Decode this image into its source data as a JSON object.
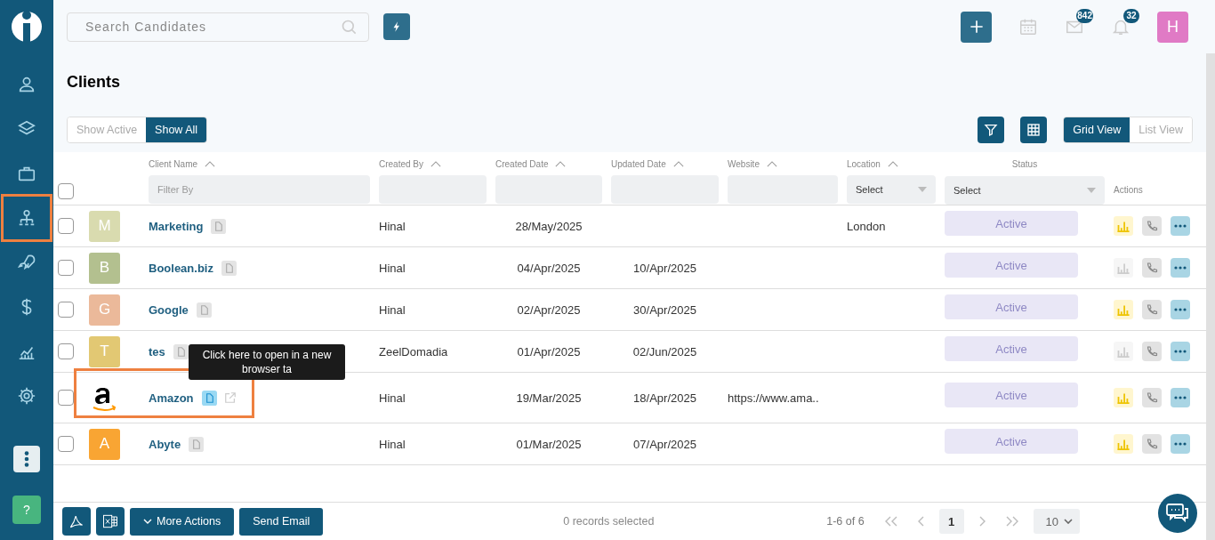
{
  "sidebar": {
    "items": [
      {
        "selected": false
      },
      {
        "selected": false
      },
      {
        "selected": false
      },
      {
        "selected": true
      },
      {
        "selected": false
      },
      {
        "selected": false
      },
      {
        "selected": false
      },
      {
        "selected": false
      }
    ],
    "help_label": "?"
  },
  "topbar": {
    "search": {
      "placeholder": "Search Candidates"
    },
    "mail_badge": "842",
    "bell_badge": "32",
    "avatar_letter": "H"
  },
  "page": {
    "title": "Clients",
    "filter_toggle": [
      {
        "label": "Show Active",
        "selected": false
      },
      {
        "label": "Show All",
        "selected": true
      }
    ],
    "view_toggle": [
      {
        "label": "Grid View",
        "selected": true
      },
      {
        "label": "List View",
        "selected": false
      }
    ]
  },
  "table": {
    "columns": [
      {
        "label": "Client Name",
        "sortable": true,
        "kind": "text",
        "placeholder": "Filter By"
      },
      {
        "label": "Created By",
        "sortable": true,
        "kind": "text"
      },
      {
        "label": "Created Date",
        "sortable": true,
        "kind": "text"
      },
      {
        "label": "Updated Date",
        "sortable": true,
        "kind": "text"
      },
      {
        "label": "Website",
        "sortable": true,
        "kind": "text"
      },
      {
        "label": "Location",
        "sortable": true,
        "kind": "select",
        "value": "Select"
      },
      {
        "label": "Status",
        "sortable": false,
        "kind": "select",
        "value": "Select"
      },
      {
        "label": "Actions",
        "sortable": false,
        "kind": "none"
      }
    ],
    "select_all_checked": false,
    "rows": [
      {
        "avatar": {
          "kind": "letter",
          "letter": "M",
          "color": "#d9dbaf"
        },
        "name": "Marketing",
        "hovered": false,
        "created_by": "Hinal",
        "created_date": "28/May/2025",
        "updated_date": "",
        "website": "",
        "location": "London",
        "status": "Active",
        "report_active": true,
        "highlighted": false,
        "checked": false
      },
      {
        "avatar": {
          "kind": "letter",
          "letter": "B",
          "color": "#b3c08f"
        },
        "name": "Boolean.biz",
        "hovered": false,
        "created_by": "Hinal",
        "created_date": "04/Apr/2025",
        "updated_date": "10/Apr/2025",
        "website": "",
        "location": "",
        "status": "Active",
        "report_active": false,
        "highlighted": false,
        "checked": false
      },
      {
        "avatar": {
          "kind": "letter",
          "letter": "G",
          "color": "#ebb99a"
        },
        "name": "Google",
        "hovered": false,
        "created_by": "Hinal",
        "created_date": "02/Apr/2025",
        "updated_date": "30/Apr/2025",
        "website": "",
        "location": "",
        "status": "Active",
        "report_active": true,
        "highlighted": false,
        "checked": false
      },
      {
        "avatar": {
          "kind": "letter",
          "letter": "T",
          "color": "#e2c873"
        },
        "name": "tes",
        "hovered": false,
        "created_by": "ZeelDomadia",
        "created_date": "01/Apr/2025",
        "updated_date": "02/Jun/2025",
        "website": "",
        "location": "",
        "status": "Active",
        "report_active": false,
        "highlighted": false,
        "checked": false
      },
      {
        "avatar": {
          "kind": "logo"
        },
        "name": "Amazon",
        "hovered": true,
        "created_by": "Hinal",
        "created_date": "19/Mar/2025",
        "updated_date": "18/Apr/2025",
        "website": "https://www.ama..",
        "location": "",
        "status": "Active",
        "report_active": true,
        "highlighted": true,
        "checked": false
      },
      {
        "avatar": {
          "kind": "letter",
          "letter": "A",
          "color": "#f9a533"
        },
        "name": "Abyte",
        "hovered": false,
        "created_by": "Hinal",
        "created_date": "01/Mar/2025",
        "updated_date": "07/Apr/2025",
        "website": "",
        "location": "",
        "status": "Active",
        "report_active": true,
        "highlighted": false,
        "checked": false
      }
    ],
    "tooltip": "Click here to open in a new browser ta"
  },
  "footer": {
    "more_actions": "More Actions",
    "send_email": "Send Email",
    "selection": "0 records selected",
    "range": "1-6 of 6",
    "pages": [
      {
        "label": "1",
        "selected": true
      }
    ],
    "page_size": "10"
  }
}
